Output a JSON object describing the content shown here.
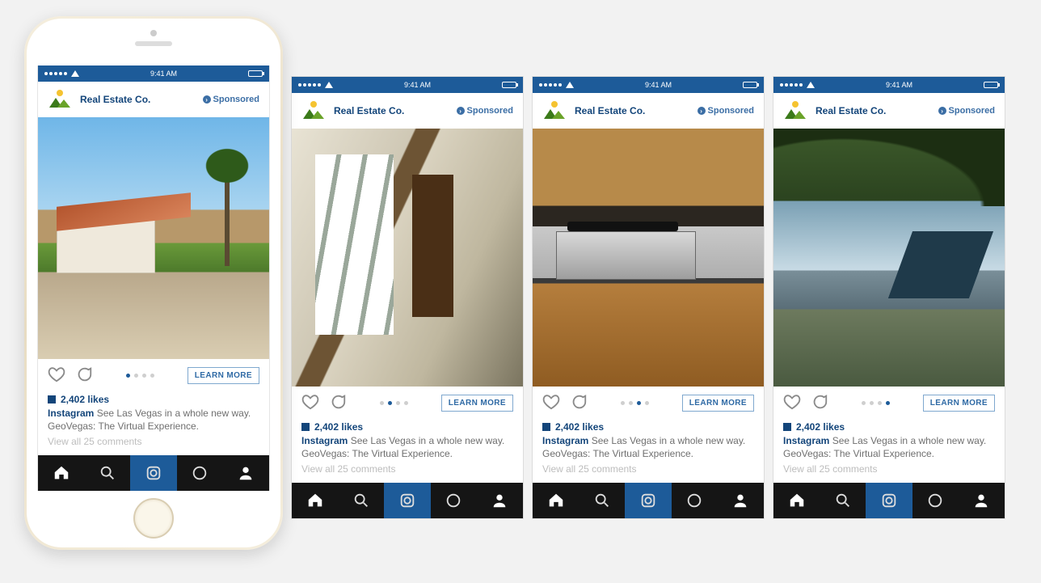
{
  "status": {
    "carrier_dots": 5,
    "time": "9:41 AM"
  },
  "account": {
    "name": "Real Estate Co."
  },
  "sponsored_label": "Sponsored",
  "cta_label": "LEARN MORE",
  "likes_count": "2,402 likes",
  "caption_handle": "Instagram",
  "caption_text": "See Las Vegas in a whole new way. GeoVegas: The Virtual Experience.",
  "view_comments": "View all 25 comments",
  "cards": [
    {
      "image_variant": "exterior",
      "active_dot": 0
    },
    {
      "image_variant": "interior",
      "active_dot": 1
    },
    {
      "image_variant": "kitchen",
      "active_dot": 2
    },
    {
      "image_variant": "pool",
      "active_dot": 3
    }
  ],
  "colors": {
    "ig_blue": "#1d5b99",
    "link_blue": "#13457a"
  }
}
